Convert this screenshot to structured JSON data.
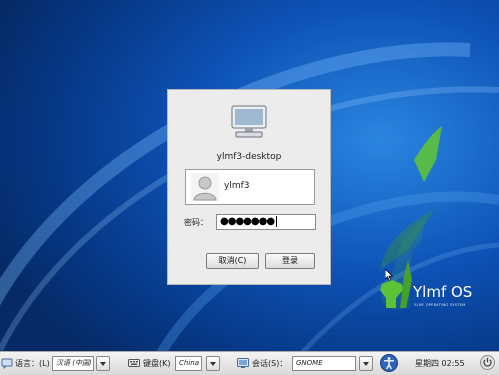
{
  "login": {
    "hostname": "ylmf3-desktop",
    "username": "ylmf3",
    "password_label": "密码：",
    "password_mask": "●●●●●●●",
    "cancel_label": "取消(C)",
    "login_label": "登录"
  },
  "brand": {
    "name": "Ylmf OS",
    "tagline": "YLMF OPERATING SYSTEM"
  },
  "bottom_bar": {
    "language_label": "语言：(L)",
    "language_value": "汉语 (中国)",
    "keyboard_label": "键盘(K)",
    "keyboard_value": "China",
    "session_label": "会话(S)：",
    "session_value": "GNOME",
    "clock": "星期四 02:55"
  },
  "colors": {
    "desktop": "#0d52b6",
    "logo_green": "#5cc238",
    "panel": "#ececec"
  },
  "icons": [
    "computer-icon",
    "user-avatar-icon",
    "language-icon",
    "keyboard-icon",
    "session-icon",
    "accessibility-icon",
    "power-icon",
    "chevron-down-icon"
  ]
}
